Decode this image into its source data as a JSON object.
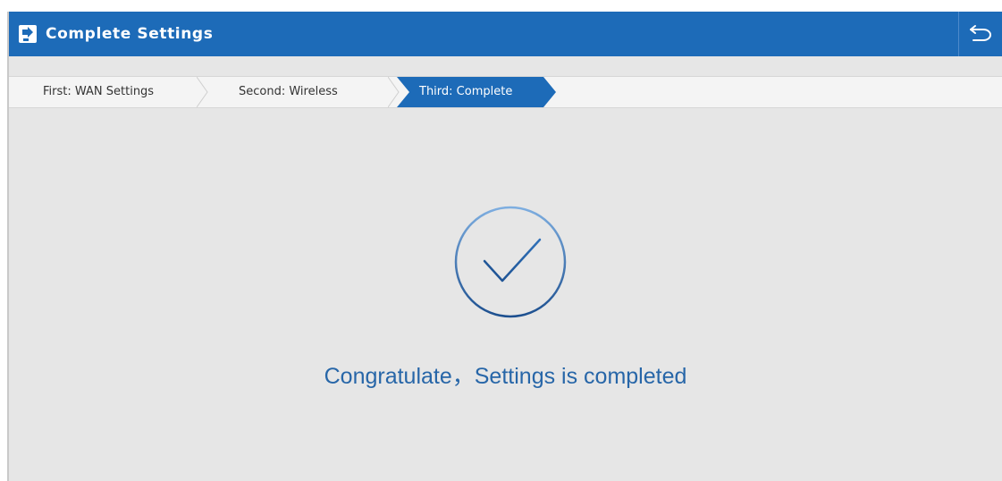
{
  "header": {
    "title": "Complete Settings",
    "title_icon": "settings-document-icon",
    "back_icon": "back-arrow-icon"
  },
  "steps": [
    {
      "label": "First: WAN Settings",
      "active": false
    },
    {
      "label": "Second: Wireless",
      "active": false
    },
    {
      "label": "Third: Complete",
      "active": true
    }
  ],
  "main": {
    "status_icon": "checkmark-circle-icon",
    "message": "Congratulate，Settings is completed"
  },
  "colors": {
    "header_bg": "#1d6bb8",
    "active_step": "#1d6bb8",
    "message_text": "#2766a8",
    "panel_bg": "#e6e6e6"
  }
}
